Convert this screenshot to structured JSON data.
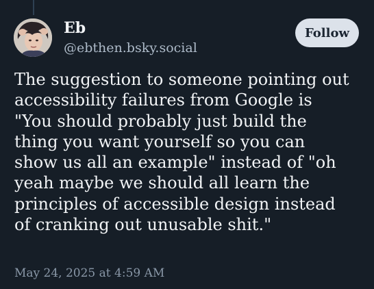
{
  "post": {
    "author": {
      "display_name": "Eb",
      "handle": "@ebthen.bsky.social"
    },
    "follow_label": "Follow",
    "text_lines": [
      "The suggestion to someone pointing out",
      "accessibility failures from Google is",
      "\"You should probably just build the",
      "thing you want yourself so you can",
      "show us all an example\" instead of \"oh",
      "yeah maybe we should all learn the",
      "principles of accessible design instead",
      "of cranking out unusable shit.\""
    ],
    "timestamp": "May 24, 2025 at 4:59 AM"
  },
  "colors": {
    "background": "#161e27",
    "text": "#f1f3f5",
    "handle": "#aebbc9",
    "timestamp": "#8a98a8",
    "follow_button_bg": "#dce2ea",
    "follow_button_text": "#1b2531"
  },
  "icons": {
    "avatar": "user-avatar-photo"
  }
}
